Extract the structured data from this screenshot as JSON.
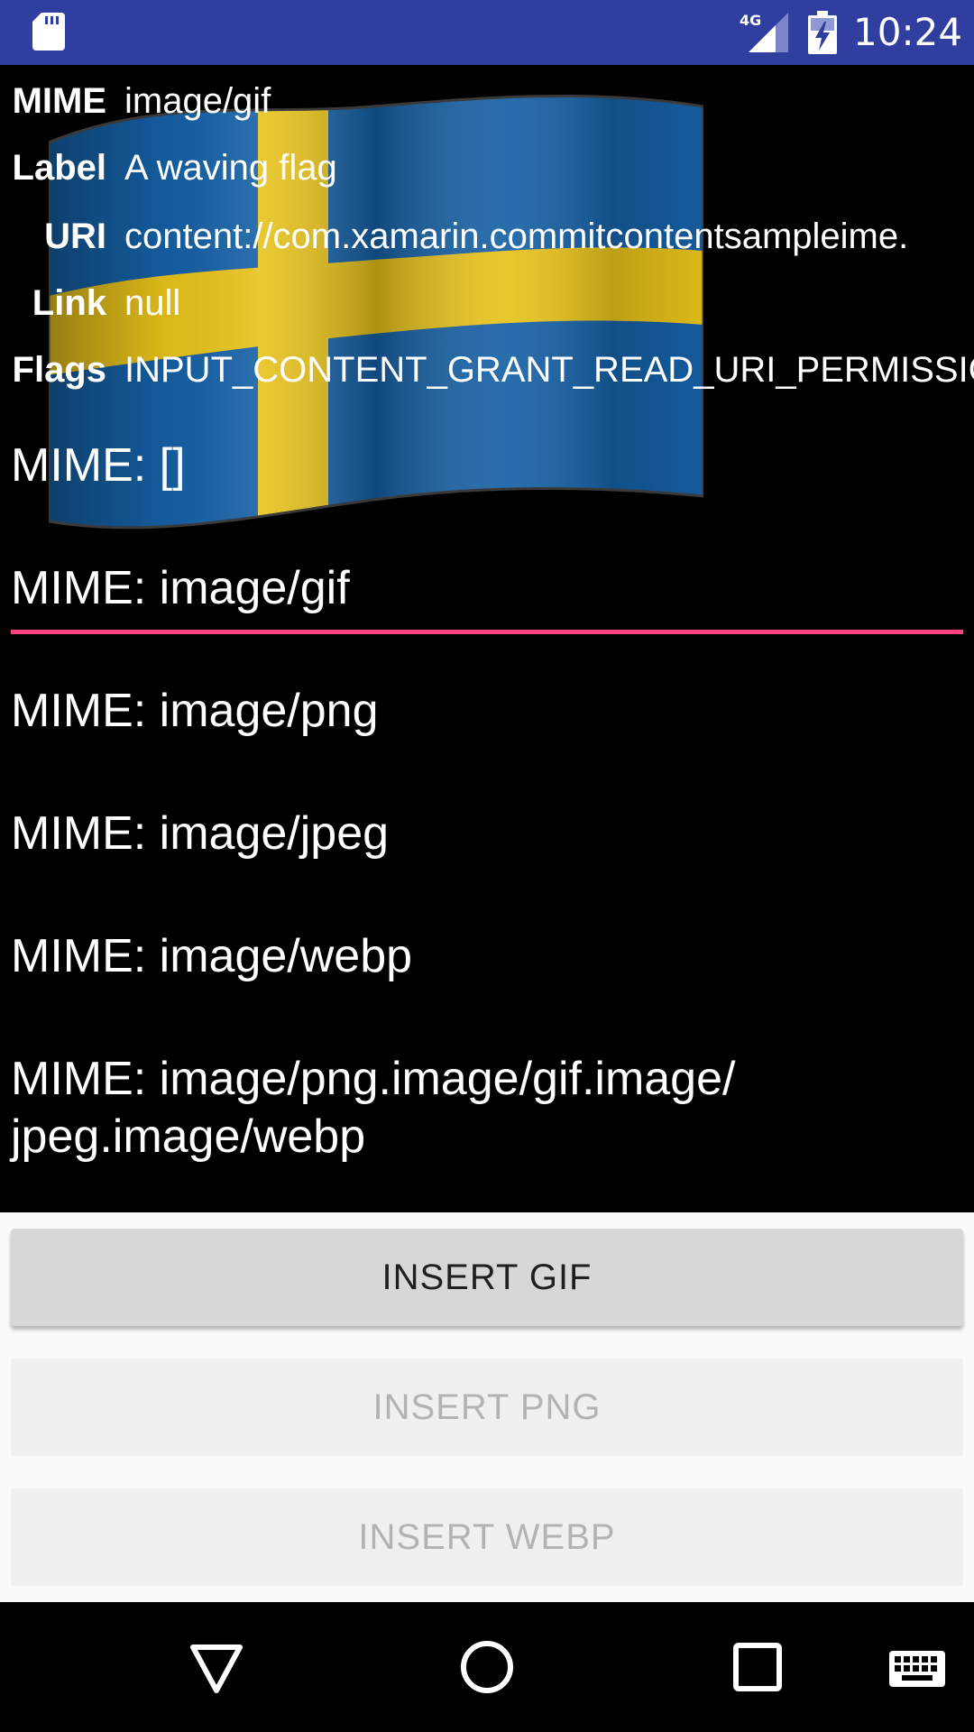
{
  "status_bar": {
    "time": "10:24",
    "network": "4G",
    "icons": [
      "sd-card-icon",
      "signal-icon",
      "battery-charging-icon"
    ]
  },
  "info": {
    "rows": [
      {
        "key": "MIME",
        "value": "image/gif"
      },
      {
        "key": "Label",
        "value": "A waving flag"
      },
      {
        "key": "URI",
        "value": "content://com.xamarin.commitcontentsampleime."
      },
      {
        "key": "Link",
        "value": "null"
      },
      {
        "key": "Flags",
        "value": "INPUT_CONTENT_GRANT_READ_URI_PERMISSION"
      }
    ]
  },
  "flag_image": {
    "description_icon": "swedish-flag-image",
    "colors": {
      "blue": "#1560A5",
      "yellow": "#F3C60F"
    }
  },
  "fields": [
    {
      "text": "MIME: []",
      "focused": false
    },
    {
      "text": "MIME: image/gif",
      "focused": true
    },
    {
      "text": "MIME: image/png",
      "focused": false
    },
    {
      "text": "MIME: image/jpeg",
      "focused": false
    },
    {
      "text": "MIME: image/webp",
      "focused": false
    },
    {
      "text_line1": "MIME: image/png.image/gif.image/",
      "text_line2": "jpeg.image/webp",
      "focused": false
    }
  ],
  "buttons": [
    {
      "label": "INSERT GIF",
      "enabled": true
    },
    {
      "label": "INSERT PNG",
      "enabled": false
    },
    {
      "label": "INSERT WEBP",
      "enabled": false
    }
  ],
  "nav": {
    "icons": [
      "back-icon",
      "home-icon",
      "recents-icon",
      "keyboard-icon"
    ]
  },
  "colors": {
    "status_bar": "#303F9F",
    "accent": "#FF4081",
    "background": "#000000"
  }
}
